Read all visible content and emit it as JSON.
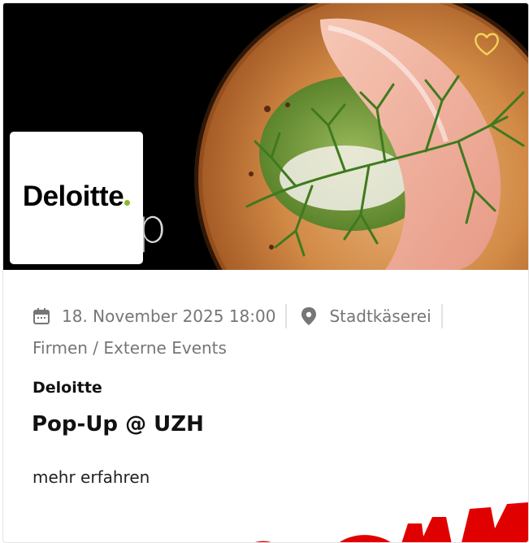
{
  "event": {
    "hero_text_left": "",
    "hero_text_right": "op",
    "organizer_logo": "Deloitte",
    "date": "18. November 2025 18:00",
    "location": "Stadtkäserei",
    "category": "Firmen / Externe Events",
    "organizer": "Deloitte",
    "title": "Pop-Up @ UZH",
    "more_link": "mehr erfahren"
  },
  "icons": {
    "calendar": "calendar-icon",
    "location": "location-pin-icon",
    "favorite": "heart-outline-icon"
  },
  "colors": {
    "accent_heart": "#f2d45a",
    "logo_dot": "#86bc25",
    "meta_text": "#767676",
    "stamp_red": "#e00000"
  }
}
